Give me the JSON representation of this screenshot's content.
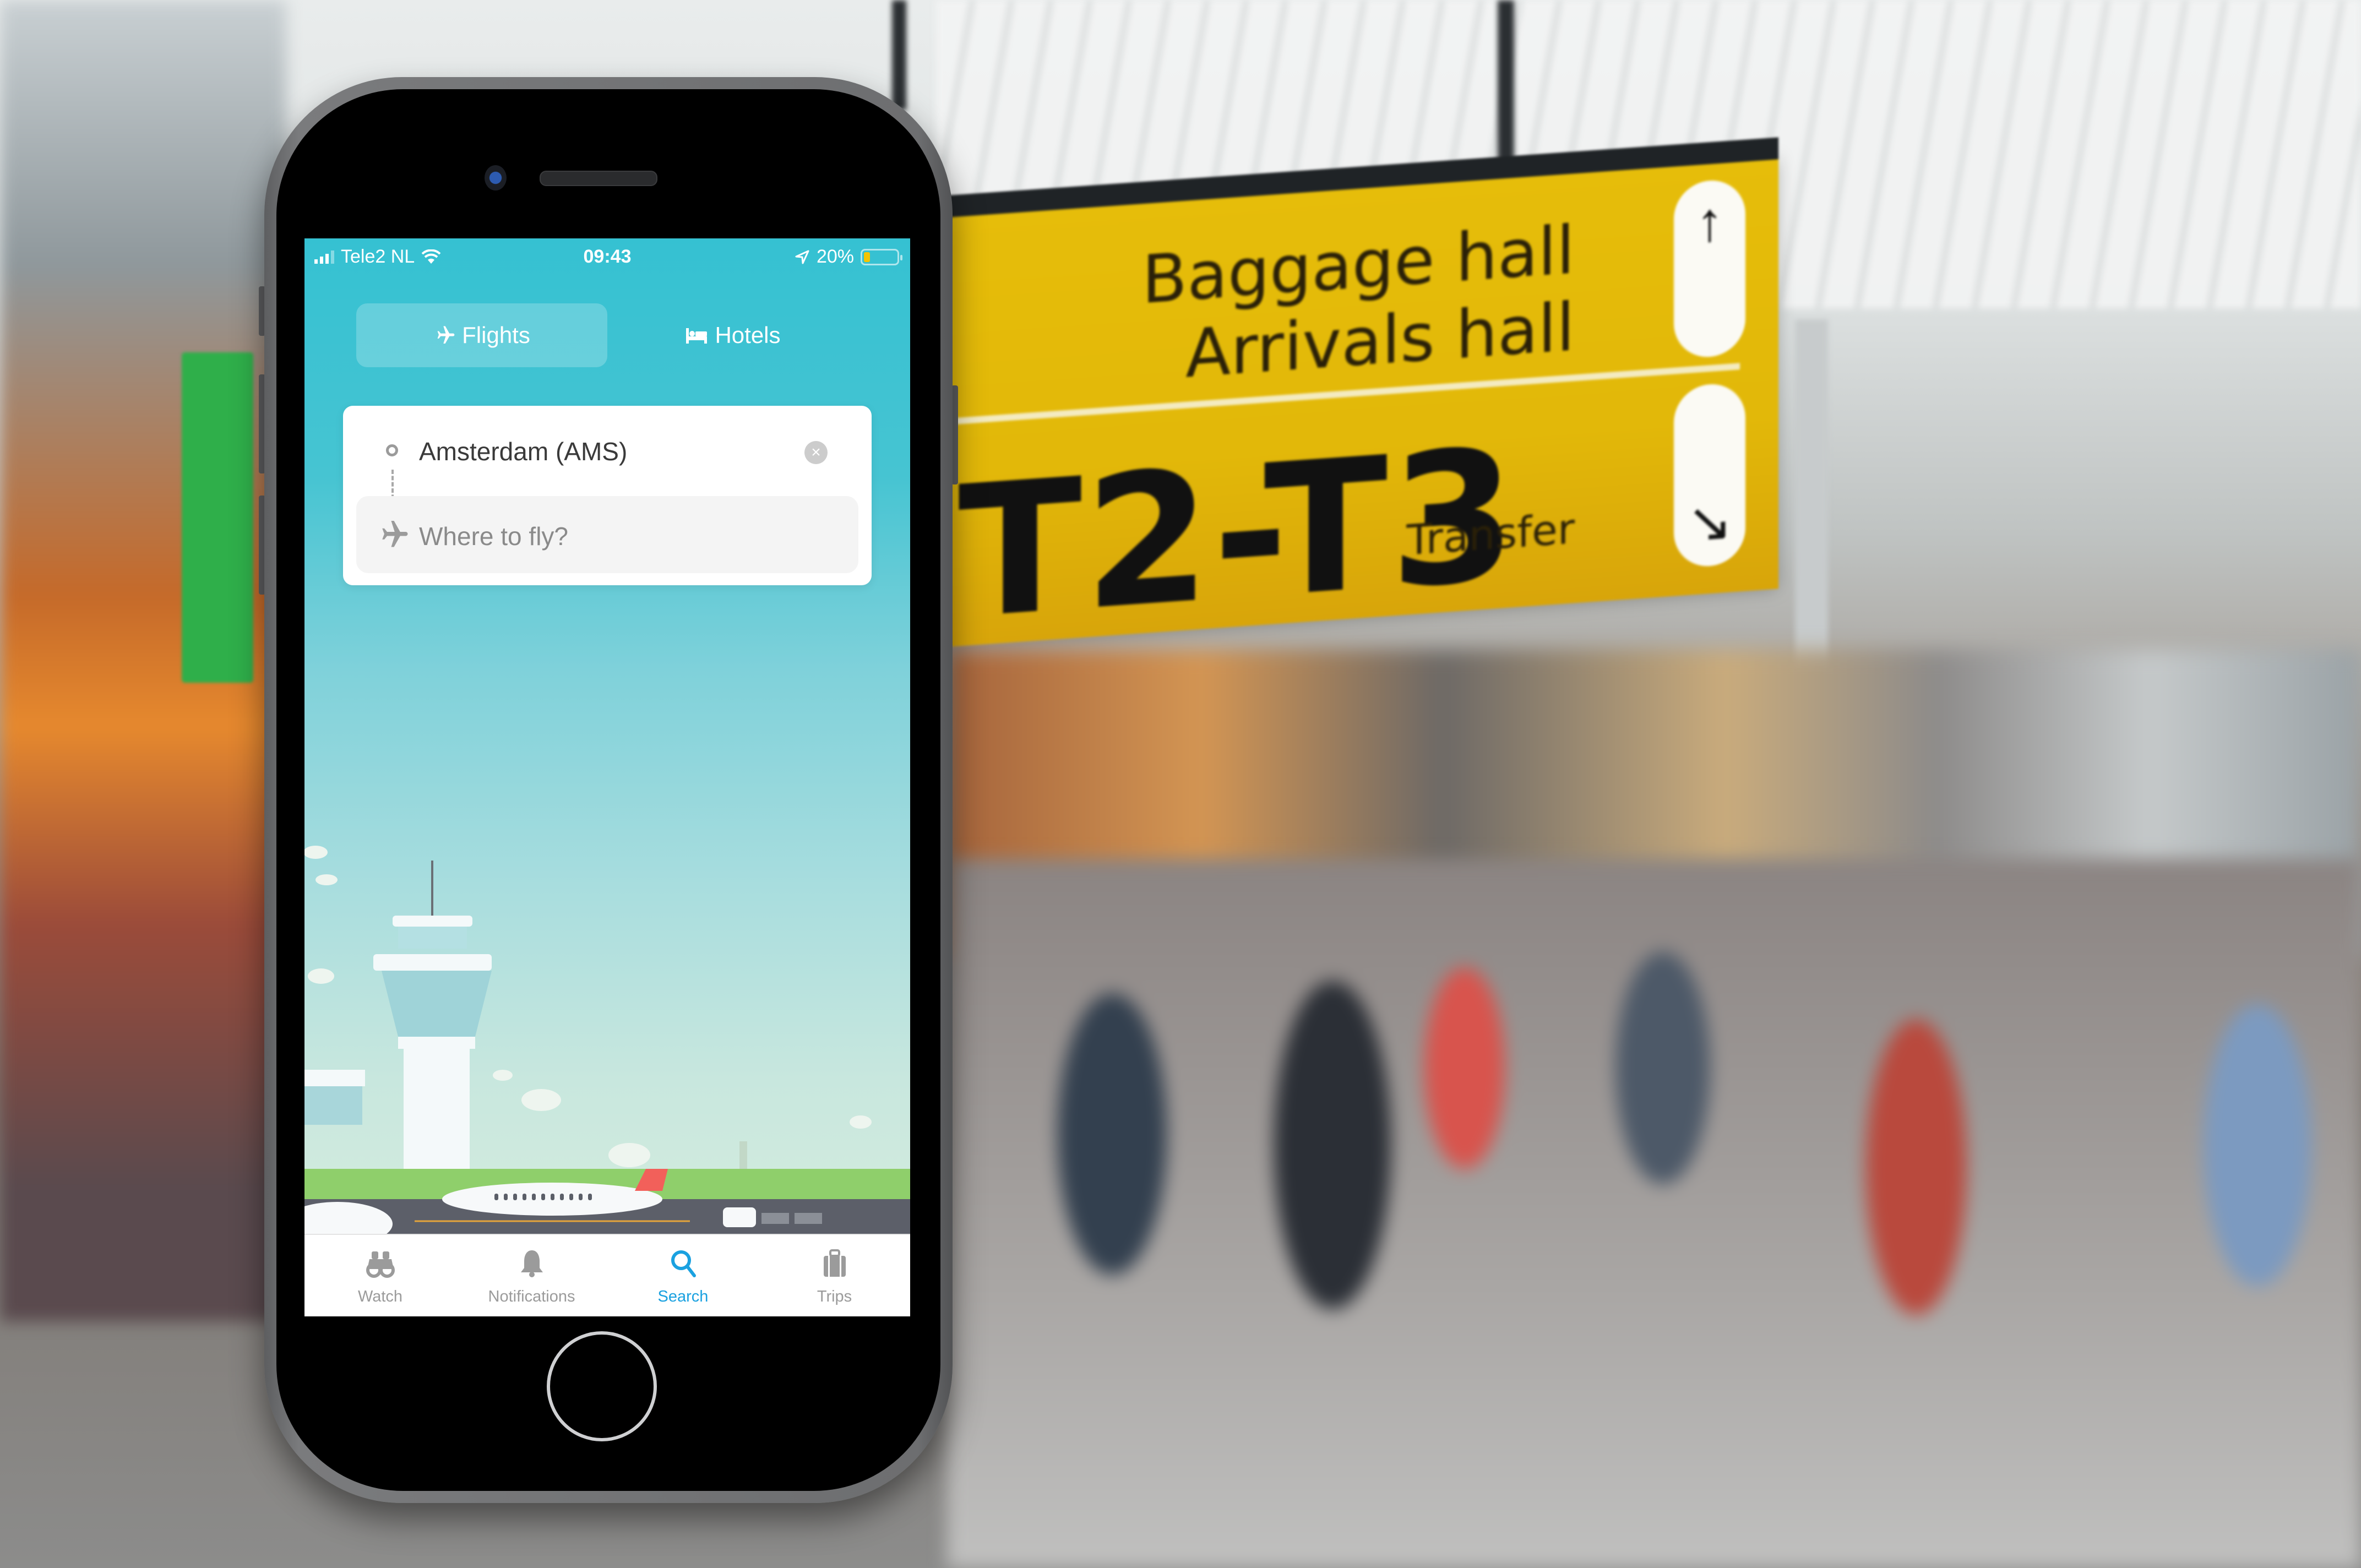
{
  "background": {
    "sign": {
      "line1": "Baggage hall",
      "line2": "Arrivals hall",
      "terminals": "T2-T3",
      "transfer": "Transfer",
      "arrow_up": "↑",
      "arrow_down": "↘",
      "color": "#e3b90a"
    }
  },
  "status_bar": {
    "carrier": "Tele2 NL",
    "time": "09:43",
    "battery_percent_label": "20%",
    "battery_level": 0.2,
    "icons": [
      "signal-icon",
      "wifi-icon",
      "location-arrow-icon",
      "battery-icon"
    ]
  },
  "mode_tabs": [
    {
      "label": "Flights",
      "icon": "airplane-icon",
      "active": true
    },
    {
      "label": "Hotels",
      "icon": "bed-icon",
      "active": false
    }
  ],
  "search": {
    "origin_value": "Amsterdam (AMS)",
    "destination_placeholder": "Where to fly?",
    "clear_glyph": "×"
  },
  "illustration": {
    "description": "Airport scene with control tower, terminal, airplane with red tail, city skyline"
  },
  "tab_bar": [
    {
      "label": "Watch",
      "icon": "binoculars-icon",
      "active": false
    },
    {
      "label": "Notifications",
      "icon": "bell-icon",
      "active": false
    },
    {
      "label": "Search",
      "icon": "search-icon",
      "active": true
    },
    {
      "label": "Trips",
      "icon": "suitcase-icon",
      "active": false
    }
  ],
  "colors": {
    "brand_teal": "#35c1d2",
    "active_tab": "#1aa1e0",
    "inactive_tab": "#9b9b9b"
  }
}
